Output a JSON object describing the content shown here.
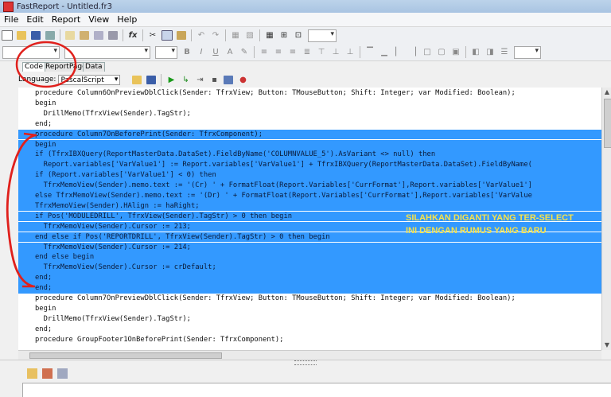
{
  "window": {
    "title": "FastReport - Untitled.fr3"
  },
  "menu": [
    "File",
    "Edit",
    "Report",
    "View",
    "Help"
  ],
  "tabs": [
    {
      "label": "Code",
      "active": true
    },
    {
      "label": "ReportPage",
      "active": false
    },
    {
      "label": "Data",
      "active": false
    }
  ],
  "script": {
    "language_label": "Language:",
    "language_value": "PascalScript"
  },
  "code_lines": [
    {
      "text": "procedure Column6OnPreviewDblClick(Sender: TfrxView; Button: TMouseButton; Shift: Integer; var Modified: Boolean);",
      "selected": false
    },
    {
      "text": "begin",
      "selected": false
    },
    {
      "text": "  DrillMemo(TfrxView(Sender).TagStr);",
      "selected": false
    },
    {
      "text": "end;",
      "selected": false
    },
    {
      "text": "procedure Column7OnBeforePrint(Sender: TfrxComponent);",
      "selected": true
    },
    {
      "text": "begin",
      "selected": true
    },
    {
      "text": "if (TfrxIBXQuery(ReportMasterData.DataSet).FieldByName('COLUMNVALUE_5').AsVariant <> null) then",
      "selected": true
    },
    {
      "text": "  Report.variables['VarValue1'] := Report.variables['VarValue1'] + TfrxIBXQuery(ReportMasterData.DataSet).FieldByName(",
      "selected": true
    },
    {
      "text": "if (Report.variables['VarValue1'] < 0) then",
      "selected": true
    },
    {
      "text": "  TfrxMemoView(Sender).memo.text := '(Cr) ' + FormatFloat(Report.Variables['CurrFormat'],Report.variables['VarValue1']",
      "selected": true
    },
    {
      "text": "else TfrxMemoView(Sender).memo.text := '(Dr) ' + FormatFloat(Report.Variables['CurrFormat'],Report.variables['VarValue",
      "selected": true
    },
    {
      "text": "TfrxMemoView(Sender).HAlign := haRight;",
      "selected": true
    },
    {
      "text": "if Pos('MODULEDRILL', TfrxView(Sender).TagStr) > 0 then begin",
      "selected": true
    },
    {
      "text": "  TfrxMemoView(Sender).Cursor := 213;",
      "selected": true
    },
    {
      "text": "end else if Pos('REPORTDRILL', TfrxView(Sender).TagStr) > 0 then begin",
      "selected": true
    },
    {
      "text": "  TfrxMemoView(Sender).Cursor := 214;",
      "selected": true
    },
    {
      "text": "end else begin",
      "selected": true
    },
    {
      "text": "  TfrxMemoView(Sender).Cursor := crDefault;",
      "selected": true
    },
    {
      "text": "end;",
      "selected": true
    },
    {
      "text": "end;",
      "selected": true
    },
    {
      "text": "procedure Column7OnPreviewDblClick(Sender: TfrxView; Button: TMouseButton; Shift: Integer; var Modified: Boolean);",
      "selected": false
    },
    {
      "text": "begin",
      "selected": false
    },
    {
      "text": "  DrillMemo(TfrxView(Sender).TagStr);",
      "selected": false
    },
    {
      "text": "end;",
      "selected": false
    },
    {
      "text": "procedure GroupFooter1OnBeforePrint(Sender: TfrxComponent);",
      "selected": false
    }
  ],
  "annotation": {
    "text": "SILAHKAN DIGANTI YANG TER-SELECT INI DENGAN    RUMUS YANG BARU",
    "color": "#f7e24a",
    "circle_color": "#e0201c"
  },
  "colors": {
    "selection": "#3399ff"
  }
}
